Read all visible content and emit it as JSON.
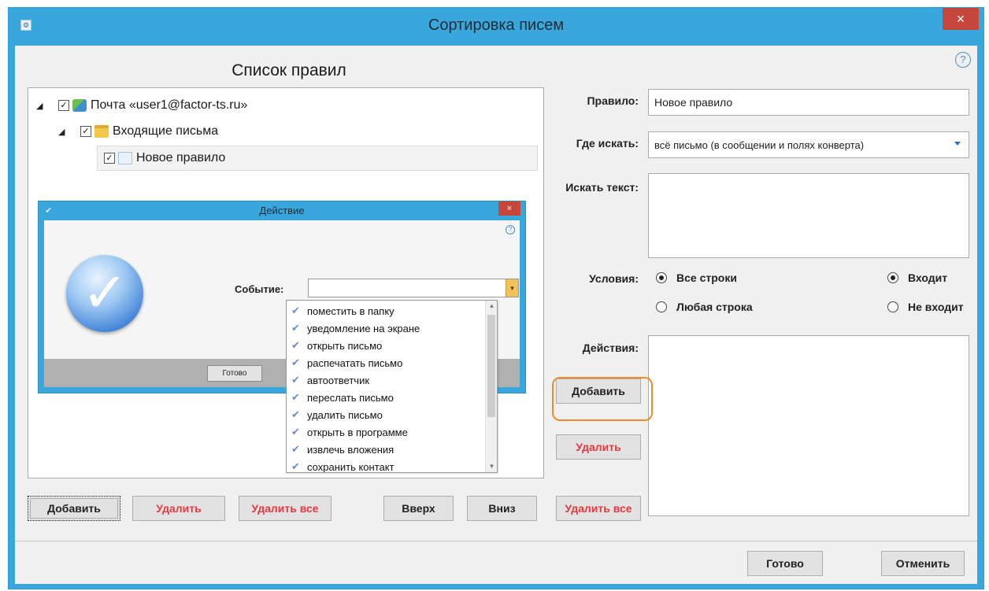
{
  "window": {
    "title": "Сортировка писем",
    "close": "×"
  },
  "help": "?",
  "rules": {
    "title": "Список правил",
    "tree": {
      "account": "Почта «user1@factor-ts.ru»",
      "folder": "Входящие письма",
      "rule": "Новое правило"
    },
    "buttons": {
      "add": "Добавить",
      "delete": "Удалить",
      "delete_all": "Удалить все",
      "up": "Вверх",
      "down": "Вниз"
    }
  },
  "action_dialog": {
    "title": "Действие",
    "close": "×",
    "help": "?",
    "event_label": "Событие:",
    "event_value": "",
    "ok": "Готово",
    "options": [
      "поместить в папку",
      "уведомление на экране",
      "открыть письмо",
      "распечатать письмо",
      "автоответчик",
      "переслать письмо",
      "удалить письмо",
      "открыть в программе",
      "извлечь вложения",
      "сохранить контакт"
    ]
  },
  "form": {
    "rule_label": "Правило:",
    "rule_value": "Новое правило",
    "where_label": "Где искать:",
    "where_value": "всё письмо (в сообщении и полях конверта)",
    "search_label": "Искать текст:",
    "search_value": "",
    "conditions_label": "Условия:",
    "cond_all": "Все строки",
    "cond_any": "Любая строка",
    "cond_contains": "Входит",
    "cond_not_contains": "Не входит",
    "actions_label": "Действия:",
    "actions_add": "Добавить",
    "actions_delete": "Удалить",
    "actions_delete_all": "Удалить все"
  },
  "footer": {
    "ok": "Готово",
    "cancel": "Отменить"
  },
  "colors": {
    "titlebar": "#3aa7dc",
    "close": "#c7463b",
    "danger": "#e8383d",
    "highlight": "#f08a2a"
  }
}
